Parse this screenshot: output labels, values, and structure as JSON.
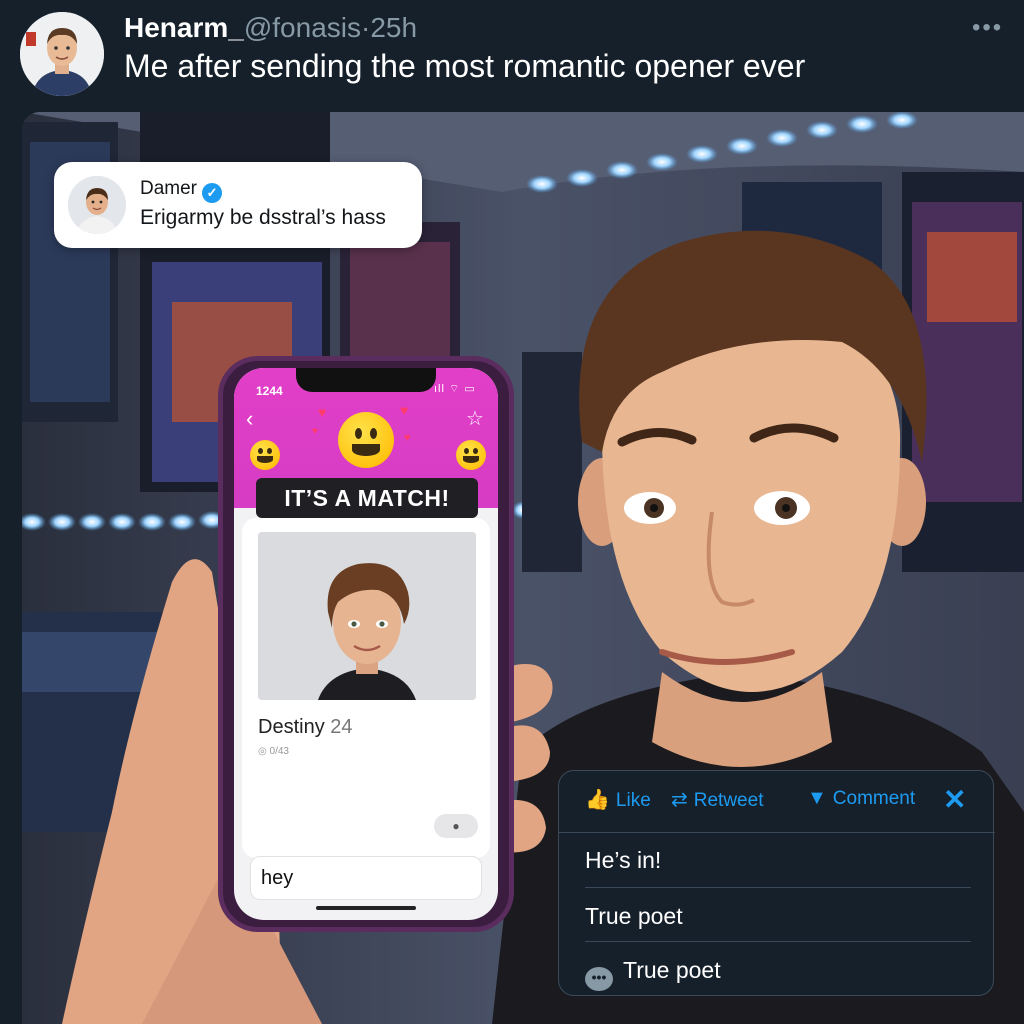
{
  "tweet": {
    "author_name": "Henarm_",
    "author_handle": "@fonasis",
    "separator": "·",
    "time": "25h",
    "text": "Me after sending the most romantic opener ever",
    "more_icon": "more-horizontal-icon"
  },
  "quote": {
    "name": "Damer",
    "text": "Erigarmy be dsstral’s hass",
    "verified_icon": "verified-badge-icon"
  },
  "phone": {
    "status_time": "1244",
    "status_icons": "ıll ⌔ ▭",
    "banner": "IT’S A MATCH!",
    "profile_name": "Destiny",
    "profile_age": "24",
    "profile_meta": "◎ 0/43",
    "toggle_text": "●",
    "message_value": "hey",
    "accent": "#e23fc8"
  },
  "actions": {
    "like": "Like",
    "retweet": "Retweet",
    "comment": "Comment",
    "replies": [
      "He’s in!",
      "True poet",
      "True poet"
    ],
    "accent": "#1d9bf0"
  }
}
